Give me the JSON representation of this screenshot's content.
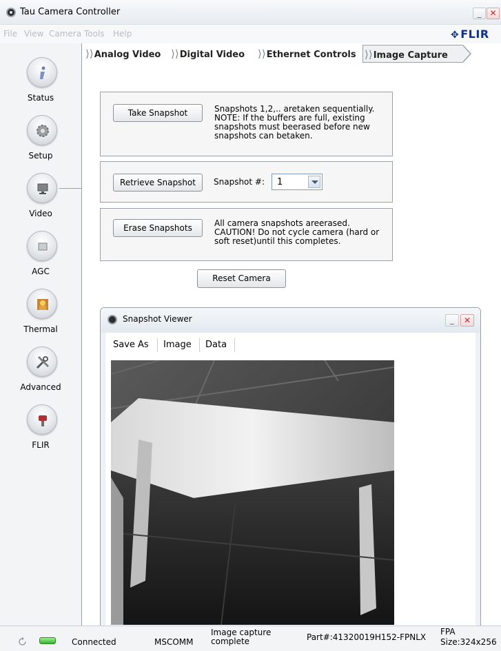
{
  "window": {
    "title": "Tau Camera Controller",
    "minimize": "_",
    "close": "✕"
  },
  "menubar": {
    "items": [
      "File",
      "View",
      "Camera",
      "Tools",
      "Help"
    ],
    "logo": "FLIR"
  },
  "sidebar": {
    "items": [
      {
        "label": "Status",
        "icon": "info-icon"
      },
      {
        "label": "Setup",
        "icon": "gear-icon"
      },
      {
        "label": "Video",
        "icon": "monitor-icon"
      },
      {
        "label": "AGC",
        "icon": "agc-icon"
      },
      {
        "label": "Thermal",
        "icon": "thermal-icon"
      },
      {
        "label": "Advanced",
        "icon": "tools-icon"
      },
      {
        "label": "FLIR",
        "icon": "camera-icon"
      }
    ],
    "active": "Video"
  },
  "tabs": [
    {
      "label": "Analog Video",
      "active": false
    },
    {
      "label": "Digital Video",
      "active": false
    },
    {
      "label": "Ethernet Controls",
      "active": false
    },
    {
      "label": "Image Capture",
      "active": true
    }
  ],
  "image_capture": {
    "take_snapshot_label": "Take Snapshot",
    "take_snapshot_note": "Snapshots 1,2,.. aretaken sequentially. NOTE: If the buffers are full, existing snapshots must beerased before new snapshots can betaken.",
    "retrieve_snapshot_label": "Retrieve Snapshot",
    "snapshot_number_label": "Snapshot #:",
    "snapshot_number_value": "1",
    "erase_snapshots_label": "Erase Snapshots",
    "erase_note": "All camera snapshots areerased. CAUTION!  Do not cycle camera (hard or soft reset)until this completes.",
    "reset_camera_label": "Reset Camera"
  },
  "snapshot_viewer": {
    "title": "Snapshot Viewer",
    "minimize": "_",
    "close": "✕",
    "menu": [
      "Save As",
      "Image",
      "Data"
    ]
  },
  "statusbar": {
    "connection": "Connected",
    "port": "MSCOMM",
    "message": "Image capture complete",
    "part": "Part#:41320019H152-FPNLX",
    "fpa_label": "FPA",
    "fpa_size": "Size:324x256",
    "led_color": "#35b32b"
  },
  "colors": {
    "logo": "#10308a",
    "close": "#c62828",
    "panel_border": "#9aa0a6"
  }
}
